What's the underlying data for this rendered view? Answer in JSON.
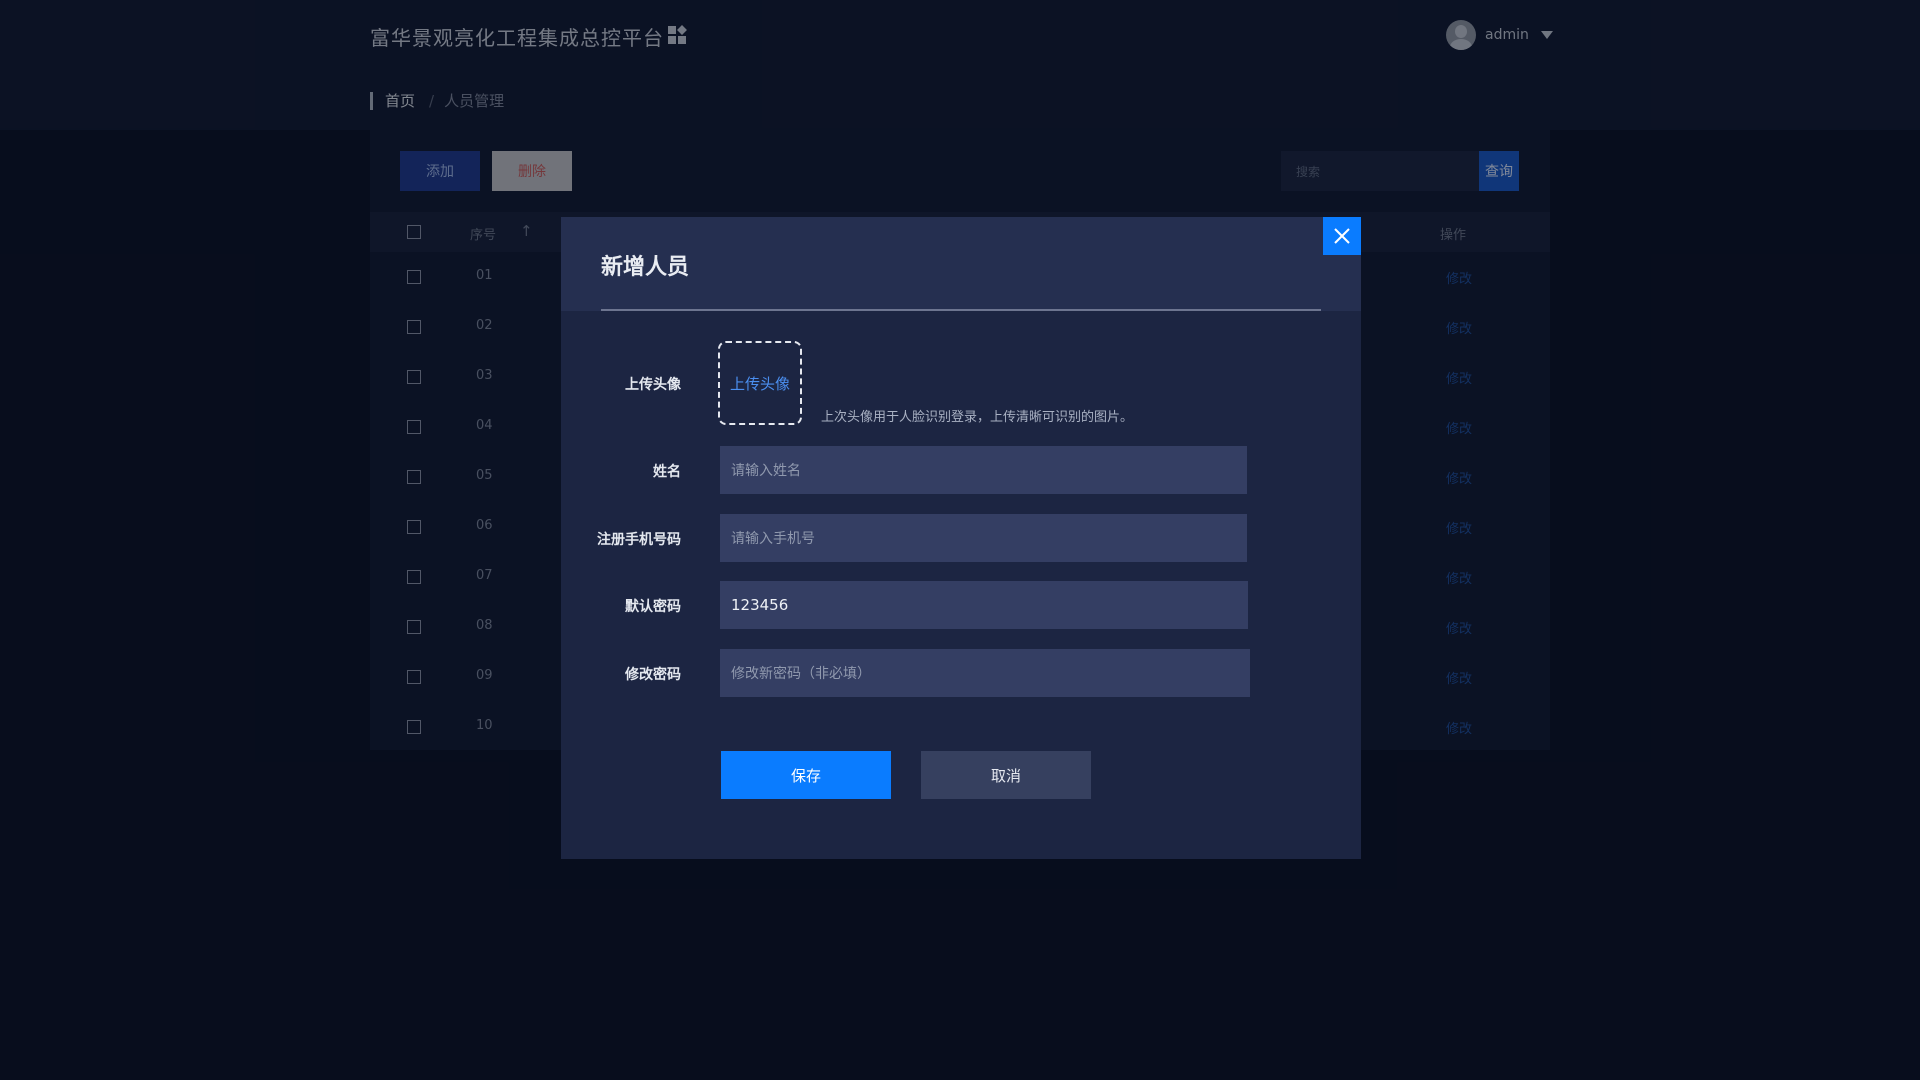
{
  "app": {
    "title": "富华景观亮化工程集成总控平台"
  },
  "user": {
    "name": "admin"
  },
  "breadcrumb": {
    "home": "首页",
    "separator": "/",
    "current": "人员管理"
  },
  "toolbar": {
    "add_label": "添加",
    "delete_label": "删除",
    "search_placeholder": "搜索",
    "query_label": "查询"
  },
  "table": {
    "headers": {
      "seq": "序号",
      "sort_arrow": "↑",
      "operation": "操作"
    },
    "rows": [
      {
        "seq": "01",
        "edit": "修改"
      },
      {
        "seq": "02",
        "edit": "修改"
      },
      {
        "seq": "03",
        "edit": "修改"
      },
      {
        "seq": "04",
        "edit": "修改"
      },
      {
        "seq": "05",
        "edit": "修改"
      },
      {
        "seq": "06",
        "edit": "修改"
      },
      {
        "seq": "07",
        "edit": "修改"
      },
      {
        "seq": "08",
        "edit": "修改"
      },
      {
        "seq": "09",
        "edit": "修改"
      },
      {
        "seq": "10",
        "edit": "修改"
      }
    ]
  },
  "modal": {
    "title": "新增人员",
    "upload": {
      "label": "上传头像",
      "button": "上传头像",
      "hint": "上次头像用于人脸识别登录，上传清晰可识别的图片。"
    },
    "name": {
      "label": "姓名",
      "placeholder": "请输入姓名"
    },
    "phone": {
      "label": "注册手机号码",
      "placeholder": "请输入手机号"
    },
    "default_password": {
      "label": "默认密码",
      "value": "123456"
    },
    "change_password": {
      "label": "修改密码",
      "placeholder": "修改新密码（非必填）"
    },
    "save_label": "保存",
    "cancel_label": "取消"
  },
  "colors": {
    "accent": "#0a7cff",
    "background": "#0c1227",
    "modal": "#1c2542",
    "link": "#1f4f9c"
  }
}
